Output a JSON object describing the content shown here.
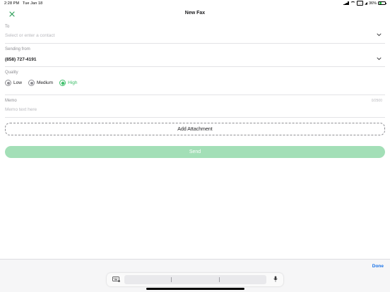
{
  "status_bar": {
    "time": "2:28 PM",
    "date": "Tue Jan 18",
    "battery_percent": "36%",
    "battery_level": 0.36
  },
  "nav": {
    "title": "New Fax",
    "close_icon": "close-icon"
  },
  "to": {
    "label": "To",
    "placeholder": "Select or enter a contact"
  },
  "sending_from": {
    "label": "Sending from",
    "value": "(858) 727-4191"
  },
  "quality": {
    "label": "Quality",
    "options": [
      {
        "label": "Low",
        "selected": false
      },
      {
        "label": "Medium",
        "selected": false
      },
      {
        "label": "High",
        "selected": true
      }
    ]
  },
  "memo": {
    "label": "Memo",
    "counter": "0/2500",
    "placeholder": "Memo text here"
  },
  "buttons": {
    "add_attachment": "Add Attachment",
    "send": "Send"
  },
  "keyboard": {
    "done": "Done"
  },
  "colors": {
    "accent_green": "#3fbf6b",
    "send_disabled": "#a3dfb7",
    "done_blue": "#1a73e8"
  }
}
